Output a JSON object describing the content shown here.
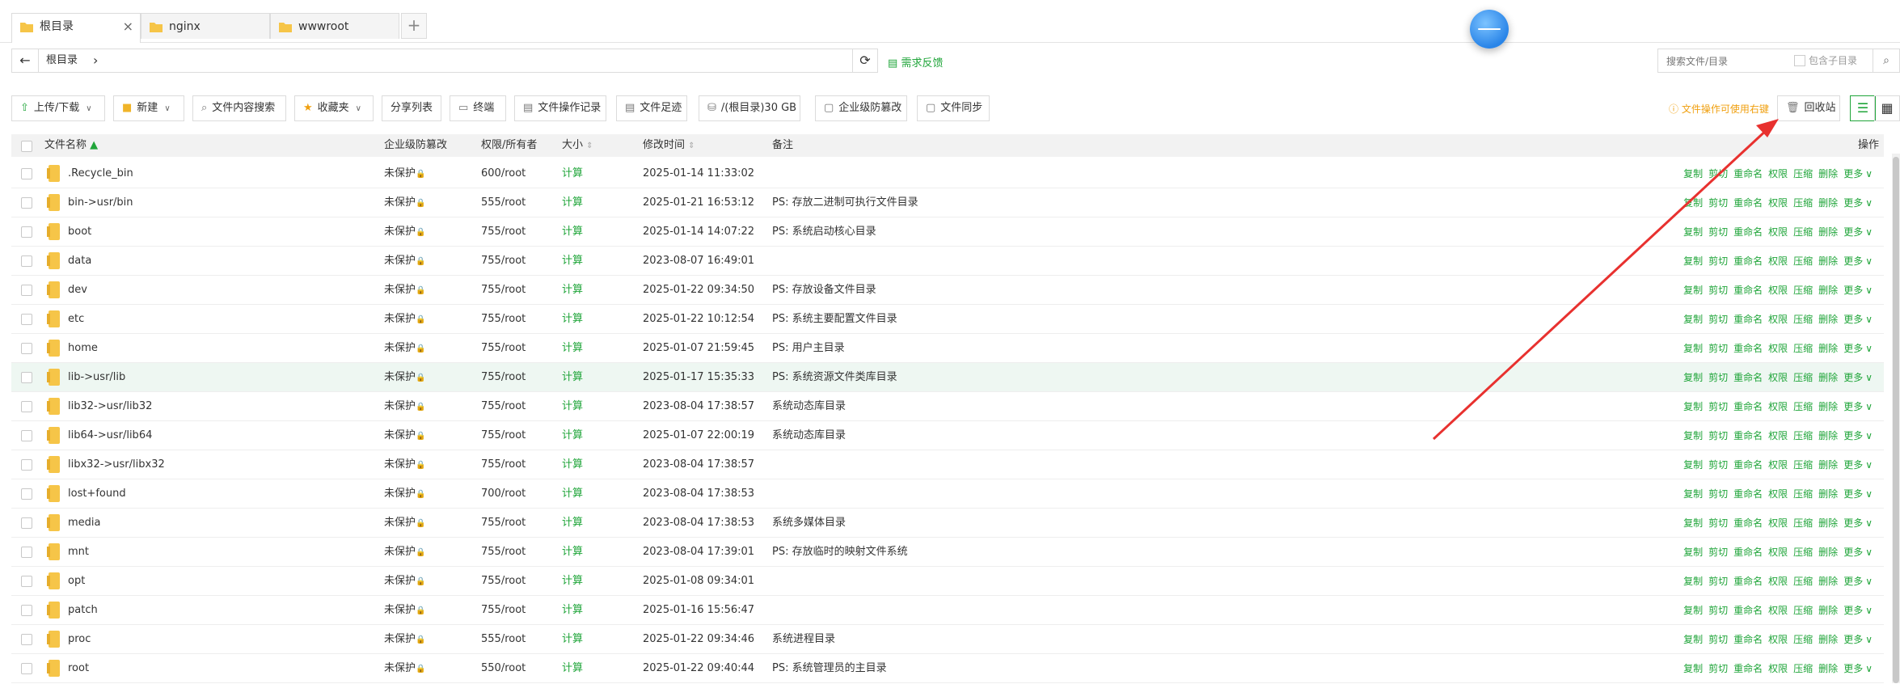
{
  "tabs": [
    {
      "label": "根目录",
      "close": "×"
    },
    {
      "label": "nginx",
      "close": "×"
    },
    {
      "label": "wwwroot",
      "close": "×"
    }
  ],
  "add_tab": "+",
  "address": {
    "crumb": "根目录",
    "arrow": "›",
    "back": "←",
    "refresh": "⟳"
  },
  "feedback": "需求反馈",
  "search": {
    "placeholder": "搜索文件/目录",
    "include_sub": "包含子目录"
  },
  "toolbar": {
    "upload": "上传/下载",
    "new": "新建",
    "content_search": "文件内容搜索",
    "favorites": "收藏夹",
    "share_list": "分享列表",
    "terminal": "终端",
    "op_log": "文件操作记录",
    "footprint": "文件足迹",
    "disk": "/(根目录)30 GB",
    "tamper": "企业级防篡改",
    "sync": "文件同步",
    "warning": "文件操作可使用右键",
    "recycle": "回收站"
  },
  "columns": {
    "name": "文件名称",
    "tamper": "企业级防篡改",
    "perm": "权限/所有者",
    "size": "大小",
    "mtime": "修改时间",
    "note": "备注",
    "ops": "操作"
  },
  "ops_labels": [
    "复制",
    "剪切",
    "重命名",
    "权限",
    "压缩",
    "删除",
    "更多"
  ],
  "rows": [
    {
      "name": ".Recycle_bin",
      "tamper": "未保护",
      "perm": "600/root",
      "size": "计算",
      "mtime": "2025-01-14 11:33:02",
      "note": ""
    },
    {
      "name": "bin->usr/bin",
      "tamper": "未保护",
      "perm": "555/root",
      "size": "计算",
      "mtime": "2025-01-21 16:53:12",
      "note": "PS: 存放二进制可执行文件目录"
    },
    {
      "name": "boot",
      "tamper": "未保护",
      "perm": "755/root",
      "size": "计算",
      "mtime": "2025-01-14 14:07:22",
      "note": "PS: 系统启动核心目录"
    },
    {
      "name": "data",
      "tamper": "未保护",
      "perm": "755/root",
      "size": "计算",
      "mtime": "2023-08-07 16:49:01",
      "note": ""
    },
    {
      "name": "dev",
      "tamper": "未保护",
      "perm": "755/root",
      "size": "计算",
      "mtime": "2025-01-22 09:34:50",
      "note": "PS: 存放设备文件目录"
    },
    {
      "name": "etc",
      "tamper": "未保护",
      "perm": "755/root",
      "size": "计算",
      "mtime": "2025-01-22 10:12:54",
      "note": "PS: 系统主要配置文件目录"
    },
    {
      "name": "home",
      "tamper": "未保护",
      "perm": "755/root",
      "size": "计算",
      "mtime": "2025-01-07 21:59:45",
      "note": "PS: 用户主目录"
    },
    {
      "name": "lib->usr/lib",
      "tamper": "未保护",
      "perm": "755/root",
      "size": "计算",
      "mtime": "2025-01-17 15:35:33",
      "note": "PS: 系统资源文件类库目录"
    },
    {
      "name": "lib32->usr/lib32",
      "tamper": "未保护",
      "perm": "755/root",
      "size": "计算",
      "mtime": "2023-08-04 17:38:57",
      "note": "系统动态库目录"
    },
    {
      "name": "lib64->usr/lib64",
      "tamper": "未保护",
      "perm": "755/root",
      "size": "计算",
      "mtime": "2025-01-07 22:00:19",
      "note": "系统动态库目录"
    },
    {
      "name": "libx32->usr/libx32",
      "tamper": "未保护",
      "perm": "755/root",
      "size": "计算",
      "mtime": "2023-08-04 17:38:57",
      "note": ""
    },
    {
      "name": "lost+found",
      "tamper": "未保护",
      "perm": "700/root",
      "size": "计算",
      "mtime": "2023-08-04 17:38:53",
      "note": ""
    },
    {
      "name": "media",
      "tamper": "未保护",
      "perm": "755/root",
      "size": "计算",
      "mtime": "2023-08-04 17:38:53",
      "note": "系统多媒体目录"
    },
    {
      "name": "mnt",
      "tamper": "未保护",
      "perm": "755/root",
      "size": "计算",
      "mtime": "2023-08-04 17:39:01",
      "note": "PS: 存放临时的映射文件系统"
    },
    {
      "name": "opt",
      "tamper": "未保护",
      "perm": "755/root",
      "size": "计算",
      "mtime": "2025-01-08 09:34:01",
      "note": ""
    },
    {
      "name": "patch",
      "tamper": "未保护",
      "perm": "755/root",
      "size": "计算",
      "mtime": "2025-01-16 15:56:47",
      "note": ""
    },
    {
      "name": "proc",
      "tamper": "未保护",
      "perm": "555/root",
      "size": "计算",
      "mtime": "2025-01-22 09:34:46",
      "note": "系统进程目录"
    },
    {
      "name": "root",
      "tamper": "未保护",
      "perm": "550/root",
      "size": "计算",
      "mtime": "2025-01-22 09:40:44",
      "note": "PS: 系统管理员的主目录"
    }
  ],
  "colors": {
    "accent": "#20a53a",
    "warning": "#f0a010",
    "arrow": "#e8312f",
    "folder": "#f6c548"
  }
}
